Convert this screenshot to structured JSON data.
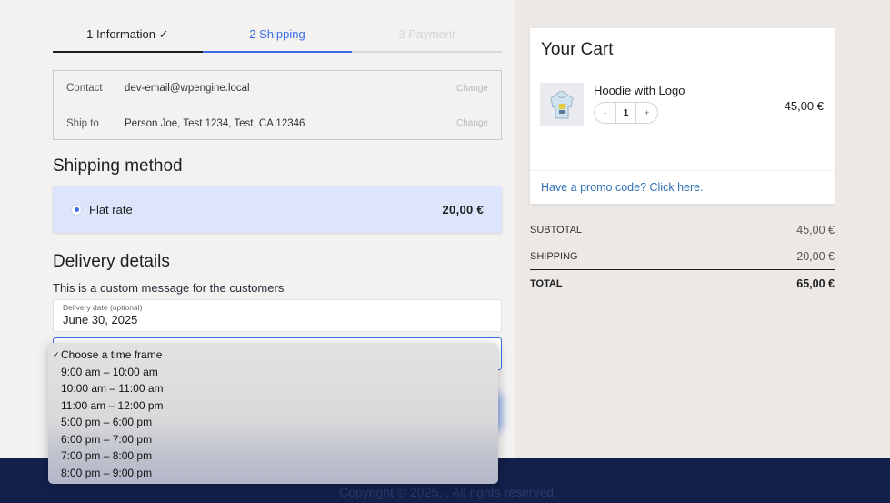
{
  "steps": [
    {
      "label": "1 Information ✓"
    },
    {
      "label": "2 Shipping"
    },
    {
      "label": "3 Payment"
    }
  ],
  "review": {
    "contact_label": "Contact",
    "contact_value": "dev-email@wpengine.local",
    "ship_label": "Ship to",
    "ship_value": "Person Joe, Test 1234, Test, CA 12346",
    "change_label": "Change"
  },
  "shipping_method": {
    "title": "Shipping method",
    "option_label": "Flat rate",
    "option_price": "20,00 €"
  },
  "delivery": {
    "title": "Delivery details",
    "custom_message": "This is a custom message for the customers",
    "date_label": "Delivery date (optional)",
    "date_value": "June 30, 2025"
  },
  "dropdown": {
    "options": [
      "Choose a time frame",
      "9:00 am – 10:00 am",
      "10:00 am – 11:00 am",
      "11:00 am – 12:00 pm",
      "5:00 pm – 6:00 pm",
      "6:00 pm – 7:00 pm",
      "7:00 pm – 8:00 pm",
      "8:00 pm – 9:00 pm"
    ],
    "check": "✓"
  },
  "cart": {
    "title": "Your Cart",
    "item_name": "Hoodie with Logo",
    "qty_minus": "-",
    "qty_value": "1",
    "qty_plus": "+",
    "item_price": "45,00 €",
    "promo": "Have a promo code? Click here."
  },
  "totals": {
    "subtotal_label": "SUBTOTAL",
    "subtotal": "45,00 €",
    "shipping_label": "SHIPPING",
    "shipping": "20,00 €",
    "total_label": "TOTAL",
    "total": "65,00 €"
  },
  "footer": {
    "copyright": "Copyright © 2025, . All rights reserved."
  },
  "colors": {
    "accent": "#3a6ee8",
    "footer_bg": "#13204a",
    "shipping_bg": "#dde5fb"
  }
}
